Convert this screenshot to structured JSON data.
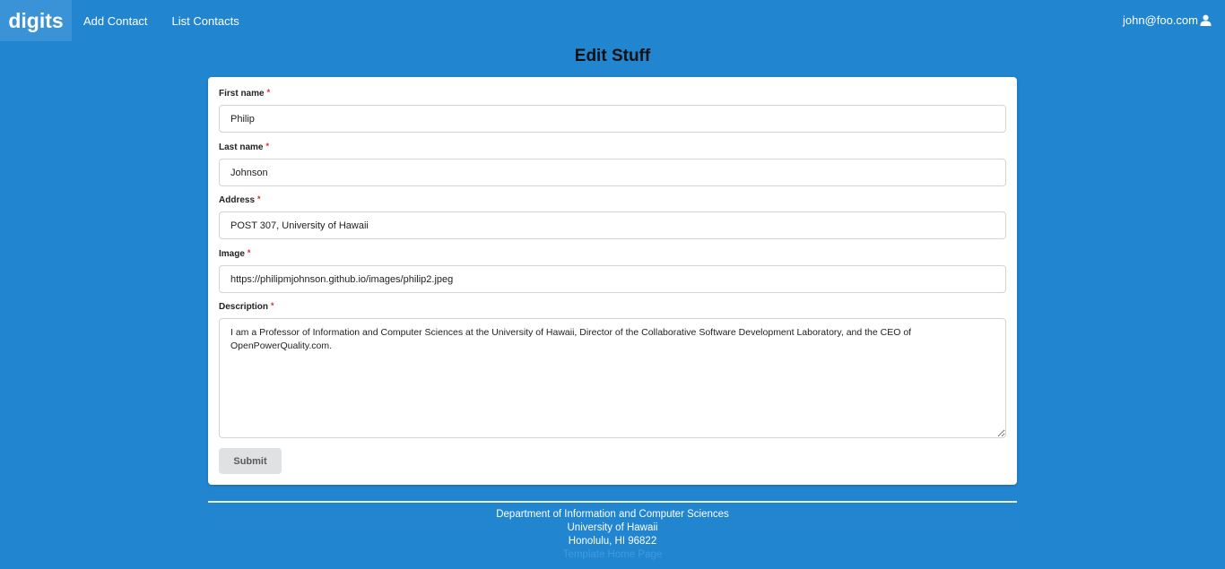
{
  "navbar": {
    "brand": "digits",
    "links": [
      "Add Contact",
      "List Contacts"
    ],
    "user": "john@foo.com",
    "user_icon": "user-icon"
  },
  "page": {
    "title": "Edit Stuff"
  },
  "form": {
    "fields": [
      {
        "label": "First name",
        "required_mark": "*",
        "value": "Philip"
      },
      {
        "label": "Last name",
        "required_mark": "*",
        "value": "Johnson"
      },
      {
        "label": "Address",
        "required_mark": "*",
        "value": "POST 307, University of Hawaii"
      },
      {
        "label": "Image",
        "required_mark": "*",
        "value": "https://philipmjohnson.github.io/images/philip2.jpeg"
      },
      {
        "label": "Description",
        "required_mark": "*",
        "value": "I am a Professor of Information and Computer Sciences at the University of Hawaii, Director of the Collaborative Software Development Laboratory, and the CEO of OpenPowerQuality.com."
      }
    ],
    "submit_label": "Submit"
  },
  "footer": {
    "line1": "Department of Information and Computer Sciences",
    "line2": "University of Hawaii",
    "line3": "Honolulu, HI 96822",
    "link": "Template Home Page"
  }
}
